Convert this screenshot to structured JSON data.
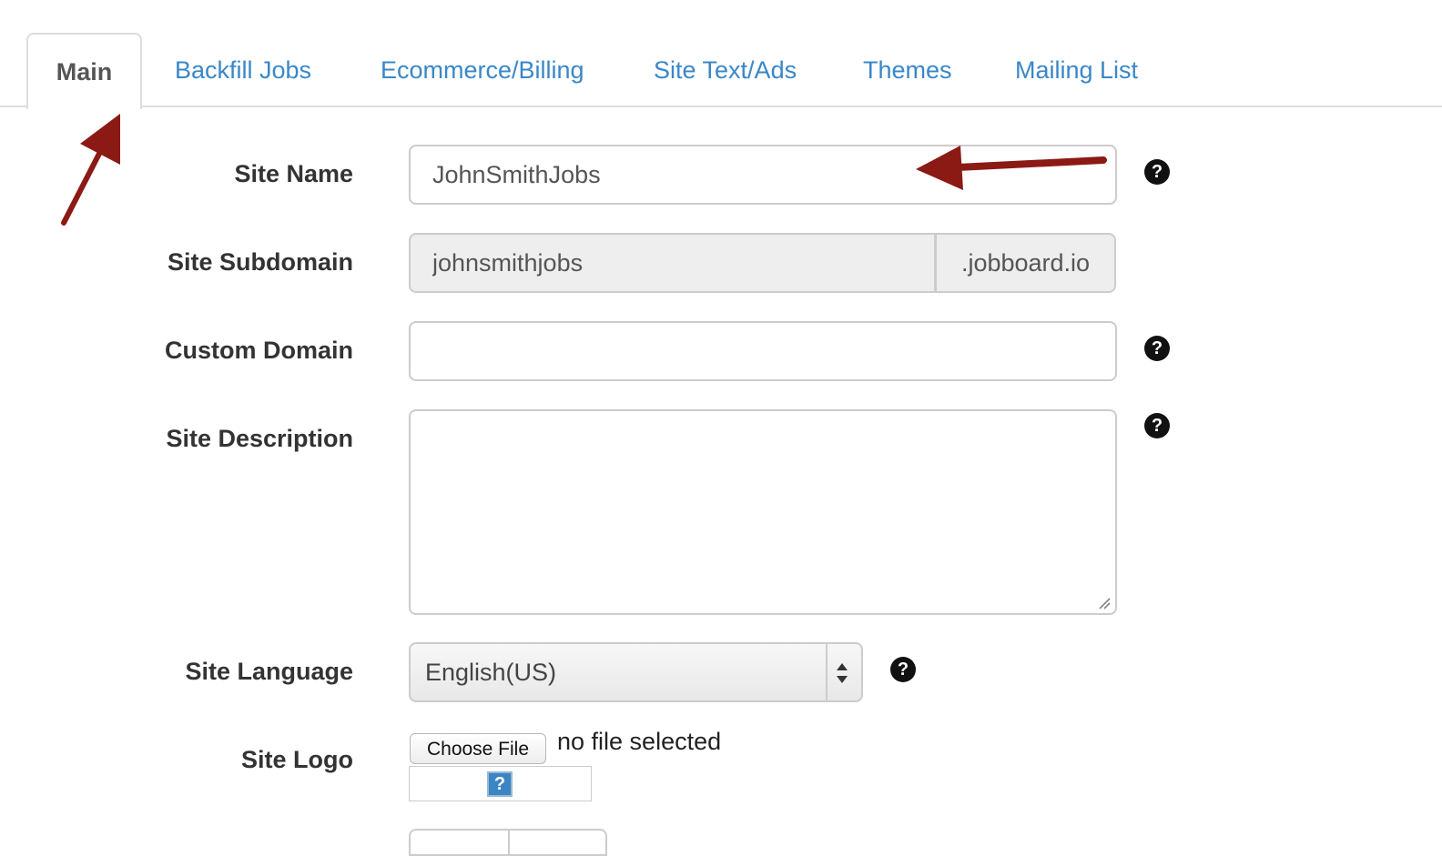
{
  "tabs": [
    {
      "label": "Main",
      "active": true
    },
    {
      "label": "Backfill Jobs"
    },
    {
      "label": "Ecommerce/Billing"
    },
    {
      "label": "Site Text/Ads"
    },
    {
      "label": "Themes"
    },
    {
      "label": "Mailing List"
    }
  ],
  "form": {
    "site_name": {
      "label": "Site Name",
      "value": "JohnSmithJobs"
    },
    "site_subdomain": {
      "label": "Site Subdomain",
      "value": "johnsmithjobs",
      "suffix": ".jobboard.io"
    },
    "custom_domain": {
      "label": "Custom Domain",
      "value": ""
    },
    "site_description": {
      "label": "Site Description",
      "value": ""
    },
    "site_language": {
      "label": "Site Language",
      "selected": "English(US)"
    },
    "site_logo": {
      "label": "Site Logo",
      "button_label": "Choose File",
      "status": "no file selected"
    },
    "help_glyph": "?"
  },
  "colors": {
    "link": "#3a87c8",
    "annotation_arrow": "#8b1a14"
  }
}
